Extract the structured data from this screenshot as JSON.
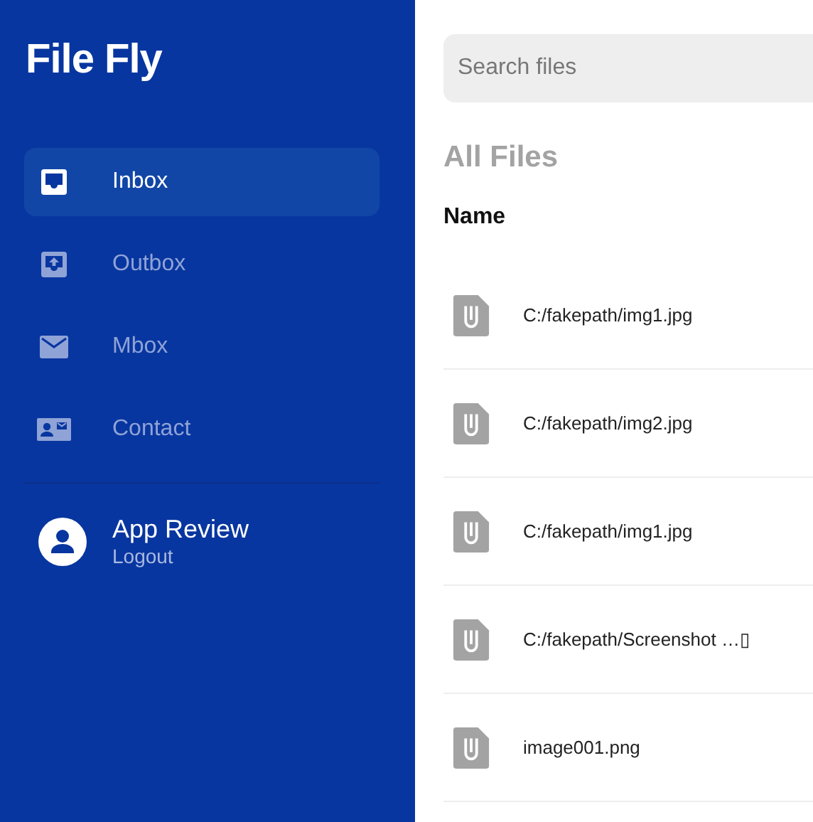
{
  "app": {
    "title": "File Fly"
  },
  "sidebar": {
    "items": [
      {
        "label": "Inbox",
        "kind": "inbox",
        "selected": true
      },
      {
        "label": "Outbox",
        "kind": "outbox",
        "selected": false
      },
      {
        "label": "Mbox",
        "kind": "mail",
        "selected": false
      },
      {
        "label": "Contact",
        "kind": "contact",
        "selected": false
      }
    ],
    "user": {
      "name": "App Review",
      "action": "Logout"
    }
  },
  "search": {
    "placeholder": "Search files"
  },
  "heading": "All Files",
  "table": {
    "columns": [
      "Name"
    ],
    "rows": [
      {
        "name": "C:/fakepath/img1.jpg"
      },
      {
        "name": "C:/fakepath/img2.jpg"
      },
      {
        "name": "C:/fakepath/img1.jpg"
      },
      {
        "name": "C:/fakepath/Screenshot …▯"
      },
      {
        "name": "image001.png"
      }
    ]
  }
}
